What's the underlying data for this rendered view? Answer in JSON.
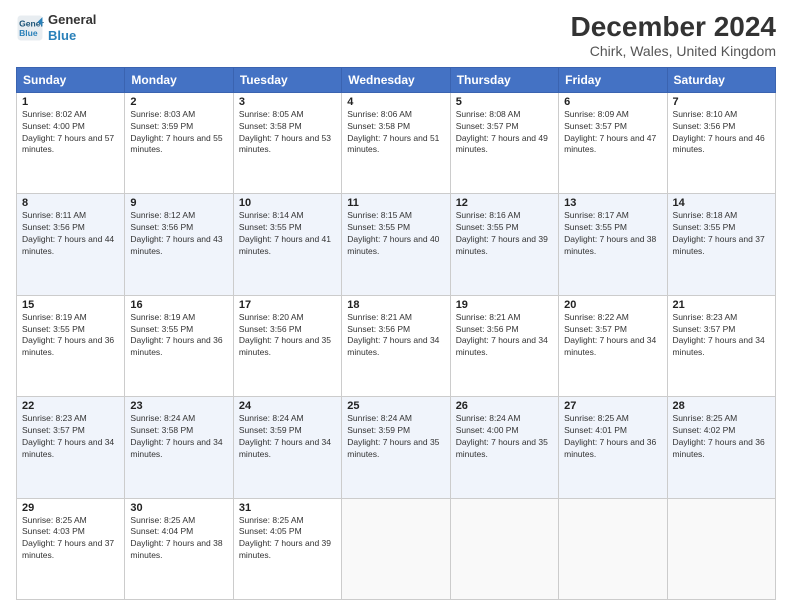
{
  "logo": {
    "line1": "General",
    "line2": "Blue"
  },
  "title": "December 2024",
  "subtitle": "Chirk, Wales, United Kingdom",
  "days_header": [
    "Sunday",
    "Monday",
    "Tuesday",
    "Wednesday",
    "Thursday",
    "Friday",
    "Saturday"
  ],
  "weeks": [
    [
      {
        "day": "1",
        "sunrise": "Sunrise: 8:02 AM",
        "sunset": "Sunset: 4:00 PM",
        "daylight": "Daylight: 7 hours and 57 minutes."
      },
      {
        "day": "2",
        "sunrise": "Sunrise: 8:03 AM",
        "sunset": "Sunset: 3:59 PM",
        "daylight": "Daylight: 7 hours and 55 minutes."
      },
      {
        "day": "3",
        "sunrise": "Sunrise: 8:05 AM",
        "sunset": "Sunset: 3:58 PM",
        "daylight": "Daylight: 7 hours and 53 minutes."
      },
      {
        "day": "4",
        "sunrise": "Sunrise: 8:06 AM",
        "sunset": "Sunset: 3:58 PM",
        "daylight": "Daylight: 7 hours and 51 minutes."
      },
      {
        "day": "5",
        "sunrise": "Sunrise: 8:08 AM",
        "sunset": "Sunset: 3:57 PM",
        "daylight": "Daylight: 7 hours and 49 minutes."
      },
      {
        "day": "6",
        "sunrise": "Sunrise: 8:09 AM",
        "sunset": "Sunset: 3:57 PM",
        "daylight": "Daylight: 7 hours and 47 minutes."
      },
      {
        "day": "7",
        "sunrise": "Sunrise: 8:10 AM",
        "sunset": "Sunset: 3:56 PM",
        "daylight": "Daylight: 7 hours and 46 minutes."
      }
    ],
    [
      {
        "day": "8",
        "sunrise": "Sunrise: 8:11 AM",
        "sunset": "Sunset: 3:56 PM",
        "daylight": "Daylight: 7 hours and 44 minutes."
      },
      {
        "day": "9",
        "sunrise": "Sunrise: 8:12 AM",
        "sunset": "Sunset: 3:56 PM",
        "daylight": "Daylight: 7 hours and 43 minutes."
      },
      {
        "day": "10",
        "sunrise": "Sunrise: 8:14 AM",
        "sunset": "Sunset: 3:55 PM",
        "daylight": "Daylight: 7 hours and 41 minutes."
      },
      {
        "day": "11",
        "sunrise": "Sunrise: 8:15 AM",
        "sunset": "Sunset: 3:55 PM",
        "daylight": "Daylight: 7 hours and 40 minutes."
      },
      {
        "day": "12",
        "sunrise": "Sunrise: 8:16 AM",
        "sunset": "Sunset: 3:55 PM",
        "daylight": "Daylight: 7 hours and 39 minutes."
      },
      {
        "day": "13",
        "sunrise": "Sunrise: 8:17 AM",
        "sunset": "Sunset: 3:55 PM",
        "daylight": "Daylight: 7 hours and 38 minutes."
      },
      {
        "day": "14",
        "sunrise": "Sunrise: 8:18 AM",
        "sunset": "Sunset: 3:55 PM",
        "daylight": "Daylight: 7 hours and 37 minutes."
      }
    ],
    [
      {
        "day": "15",
        "sunrise": "Sunrise: 8:19 AM",
        "sunset": "Sunset: 3:55 PM",
        "daylight": "Daylight: 7 hours and 36 minutes."
      },
      {
        "day": "16",
        "sunrise": "Sunrise: 8:19 AM",
        "sunset": "Sunset: 3:55 PM",
        "daylight": "Daylight: 7 hours and 36 minutes."
      },
      {
        "day": "17",
        "sunrise": "Sunrise: 8:20 AM",
        "sunset": "Sunset: 3:56 PM",
        "daylight": "Daylight: 7 hours and 35 minutes."
      },
      {
        "day": "18",
        "sunrise": "Sunrise: 8:21 AM",
        "sunset": "Sunset: 3:56 PM",
        "daylight": "Daylight: 7 hours and 34 minutes."
      },
      {
        "day": "19",
        "sunrise": "Sunrise: 8:21 AM",
        "sunset": "Sunset: 3:56 PM",
        "daylight": "Daylight: 7 hours and 34 minutes."
      },
      {
        "day": "20",
        "sunrise": "Sunrise: 8:22 AM",
        "sunset": "Sunset: 3:57 PM",
        "daylight": "Daylight: 7 hours and 34 minutes."
      },
      {
        "day": "21",
        "sunrise": "Sunrise: 8:23 AM",
        "sunset": "Sunset: 3:57 PM",
        "daylight": "Daylight: 7 hours and 34 minutes."
      }
    ],
    [
      {
        "day": "22",
        "sunrise": "Sunrise: 8:23 AM",
        "sunset": "Sunset: 3:57 PM",
        "daylight": "Daylight: 7 hours and 34 minutes."
      },
      {
        "day": "23",
        "sunrise": "Sunrise: 8:24 AM",
        "sunset": "Sunset: 3:58 PM",
        "daylight": "Daylight: 7 hours and 34 minutes."
      },
      {
        "day": "24",
        "sunrise": "Sunrise: 8:24 AM",
        "sunset": "Sunset: 3:59 PM",
        "daylight": "Daylight: 7 hours and 34 minutes."
      },
      {
        "day": "25",
        "sunrise": "Sunrise: 8:24 AM",
        "sunset": "Sunset: 3:59 PM",
        "daylight": "Daylight: 7 hours and 35 minutes."
      },
      {
        "day": "26",
        "sunrise": "Sunrise: 8:24 AM",
        "sunset": "Sunset: 4:00 PM",
        "daylight": "Daylight: 7 hours and 35 minutes."
      },
      {
        "day": "27",
        "sunrise": "Sunrise: 8:25 AM",
        "sunset": "Sunset: 4:01 PM",
        "daylight": "Daylight: 7 hours and 36 minutes."
      },
      {
        "day": "28",
        "sunrise": "Sunrise: 8:25 AM",
        "sunset": "Sunset: 4:02 PM",
        "daylight": "Daylight: 7 hours and 36 minutes."
      }
    ],
    [
      {
        "day": "29",
        "sunrise": "Sunrise: 8:25 AM",
        "sunset": "Sunset: 4:03 PM",
        "daylight": "Daylight: 7 hours and 37 minutes."
      },
      {
        "day": "30",
        "sunrise": "Sunrise: 8:25 AM",
        "sunset": "Sunset: 4:04 PM",
        "daylight": "Daylight: 7 hours and 38 minutes."
      },
      {
        "day": "31",
        "sunrise": "Sunrise: 8:25 AM",
        "sunset": "Sunset: 4:05 PM",
        "daylight": "Daylight: 7 hours and 39 minutes."
      },
      null,
      null,
      null,
      null
    ]
  ]
}
